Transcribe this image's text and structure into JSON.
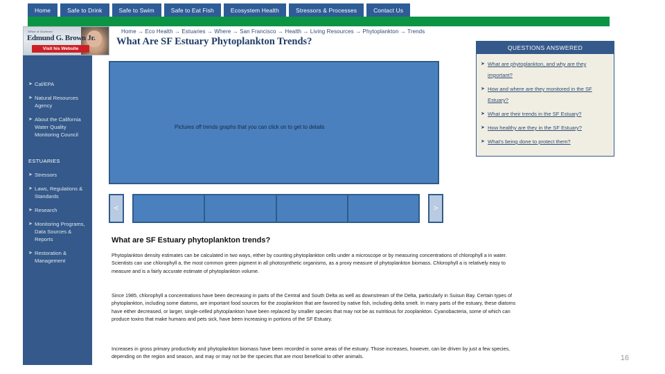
{
  "topnav": {
    "tabs": [
      {
        "label": "Home"
      },
      {
        "label": "Safe to Drink"
      },
      {
        "label": "Safe to Swim"
      },
      {
        "label": "Safe to Eat Fish"
      },
      {
        "label": "Ecosystem Health"
      },
      {
        "label": "Stressors & Processes"
      },
      {
        "label": "Contact Us"
      }
    ],
    "accent_green": "#0b9444",
    "accent_blue": "#2e5c96"
  },
  "logo": {
    "pretitle": "Office of Governor",
    "name": "Edmund G. Brown Jr.",
    "button_label": "Visit his Website",
    "button_color": "#cc2026"
  },
  "sidebar": {
    "agency_links": [
      {
        "label": "Cal/EPA"
      },
      {
        "label": "Natural Resources Agency"
      },
      {
        "label": "About the California Water Quality Monitoring Council"
      }
    ],
    "section_heading": "ESTUARIES",
    "section_links": [
      {
        "label": "Stressors"
      },
      {
        "label": "Laws, Regulations & Standards"
      },
      {
        "label": "Research"
      },
      {
        "label": "Monitoring Programs, Data Sources & Reports"
      },
      {
        "label": "Restoration & Management"
      }
    ]
  },
  "breadcrumb": "Home → Eco Health → Estuaries → Where → San Francisco → Health → Living Resources → Phytoplankton → Trends",
  "page_title": "What Are SF Estuary Phytoplankton Trends?",
  "media": {
    "caption": "Pictures off trends graphs that you can click on to get to details"
  },
  "carousel": {
    "prev_label": "<",
    "next_label": ">",
    "thumbs": [
      {
        "label": ""
      },
      {
        "label": ""
      },
      {
        "label": ""
      },
      {
        "label": ""
      }
    ]
  },
  "content": {
    "heading": "What are SF Estuary phytoplankton trends?",
    "paragraphs": [
      "Phytoplankton density estimates can be calculated in two ways, either by counting phytoplankton cells under a microscope or by measuring concentrations of chlorophyll a in water. Scientists can use chlorophyll a, the most common green pigment in all photosynthetic organisms, as a proxy measure of phytoplankton biomass. Chlorophyll a is relatively easy to measure and is a fairly accurate estimate of phytoplankton volume.",
      "Since 1985, chlorophyll a concentrations have been decreasing in parts of the Central and South Delta as well as downstream of the Delta, particularly in Suisun Bay. Certain types of phytoplankton, including some diatoms, are important food sources for the zooplankton that are favored by native fish, including delta smelt. In many parts of the estuary, these diatoms have either decreased, or larger, single-celled phytoplankton have been replaced by smaller species that may not be as nutritious for zooplankton. Cyanobacteria, some of which can produce toxins that make humans and pets sick, have been increasing in portions of the SF Estuary.",
      "Increases in gross primary productivity and phytoplankton biomass have been recorded in some areas of the estuary. Those increases, however, can be driven by just a few species, depending on the region and season, and may or may not be the species that are most beneficial to other animals."
    ]
  },
  "questions_panel": {
    "header": "QUESTIONS ANSWERED",
    "items": [
      {
        "label": "What are phytoplankton, and why are they important?"
      },
      {
        "label": "How and where are they monitored in the SF Estuary?"
      },
      {
        "label": "What are their trends in the SF Estuary?"
      },
      {
        "label": "How healthy are they in the SF Estuary?"
      },
      {
        "label": "What's being done to protect them?"
      }
    ]
  },
  "page_number": "16"
}
